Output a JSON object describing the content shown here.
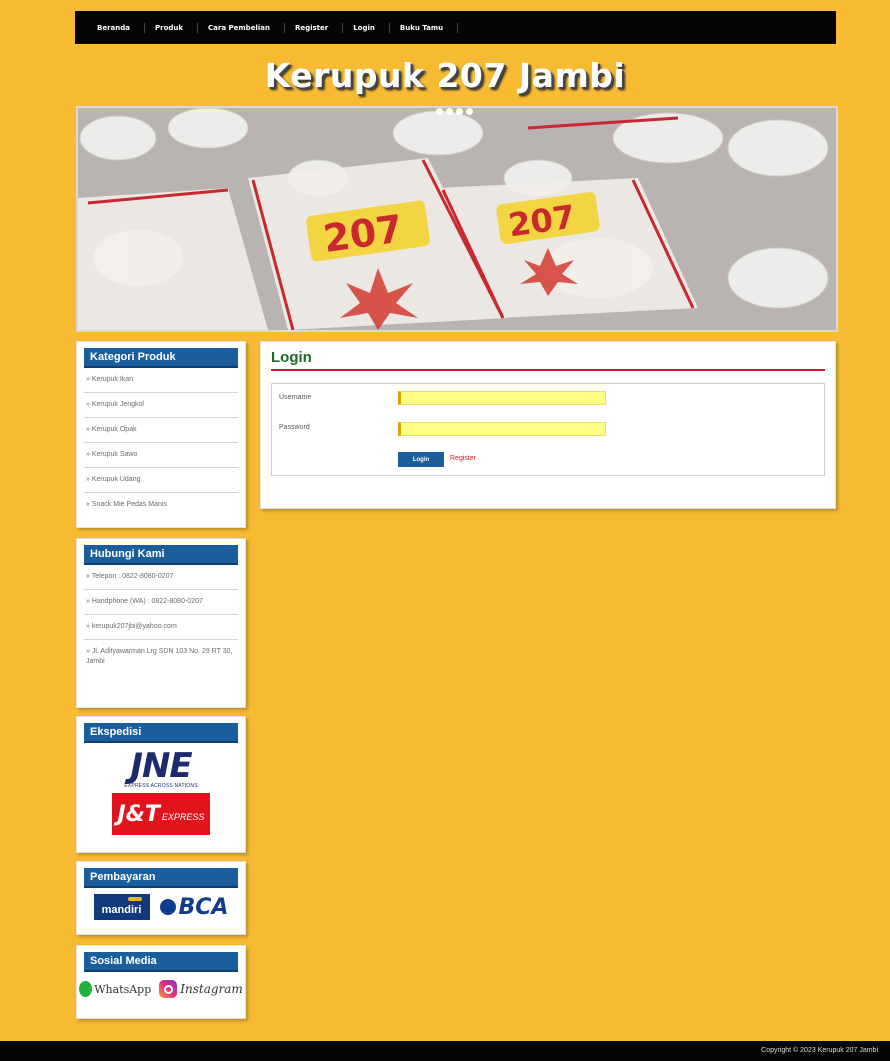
{
  "nav": {
    "items": [
      "Beranda",
      "Produk",
      "Cara Pembelian",
      "Register",
      "Login",
      "Buku Tamu"
    ]
  },
  "site": {
    "title": "Kerupuk 207 Jambi"
  },
  "sidebar": {
    "kategori": {
      "title": "Kategori Produk",
      "items": [
        "» Kerupuk Ikan",
        "» Kerupuk Jengkol",
        "» Kerupuk Opak",
        "» Kerupuk Sawo",
        "» Kerupuk Udang",
        "» Snack Mie Pedas Manis"
      ]
    },
    "hubungi": {
      "title": "Hubungi Kami",
      "items": [
        "» Telepon : 0822-8080-0207",
        "» Handphone (WA) : 0822-8080-0207",
        "» kerupuk207jbi@yahoo.com",
        "» Jl. Adityawarman Lrg SDN 103 No. 29 RT 30, Jambi"
      ]
    },
    "ekspedisi": {
      "title": "Ekspedisi",
      "jne": "JNE",
      "jne_sub": "EXPRESS ACROSS NATIONS",
      "jnt": "J&T",
      "jnt_sub": "EXPRESS"
    },
    "pembayaran": {
      "title": "Pembayaran",
      "mandiri": "mandiri",
      "bca": "BCA"
    },
    "sosial": {
      "title": "Sosial Media",
      "whatsapp": "WhatsApp",
      "instagram": "Instagram"
    }
  },
  "main": {
    "title": "Login",
    "username_label": "Username",
    "password_label": "Password",
    "username_value": "",
    "password_value": "",
    "login_button": "Login",
    "register_link": "Register"
  },
  "footer": {
    "copyright": "Copyright © 2023 Kerupuk 207 Jambi"
  },
  "colors": {
    "background": "#f6bb33",
    "nav": "#050505",
    "sidebar_head": "#1a5e9c",
    "title_green": "#1b6a2a",
    "accent_red": "#d11a2a"
  }
}
